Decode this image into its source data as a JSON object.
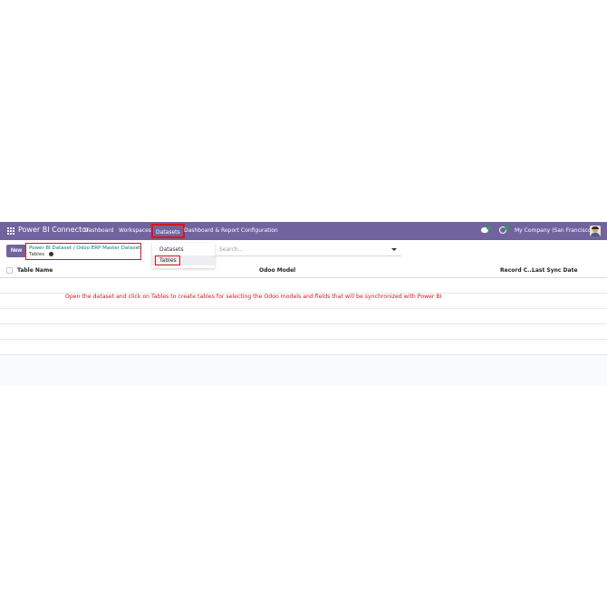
{
  "navbar": {
    "app_title": "Power BI Connector",
    "menu": [
      {
        "label": "Dashboard"
      },
      {
        "label": "Workspaces"
      },
      {
        "label": "Datasets"
      },
      {
        "label": "Dashboard & Report"
      },
      {
        "label": "Configuration"
      }
    ],
    "chat_badge_count": 8,
    "activity_badge_count": 14,
    "company": "My Company (San Francisco)"
  },
  "control_panel": {
    "new_label": "New",
    "breadcrumb": {
      "parent": "Power BI Dataset",
      "separator": "/",
      "record": "Odoo ERP Master Dataset",
      "current": "Tables"
    },
    "search_placeholder": "Search..."
  },
  "dropdown": {
    "items": [
      {
        "label": "Datasets"
      },
      {
        "label": "Tables"
      }
    ]
  },
  "table": {
    "columns": [
      "Table Name",
      "Odoo Model",
      "Record C...",
      "Last Sync Date"
    ],
    "rows": []
  },
  "annotation": "Open the dataset and click on Tables to create tables for selecting the Odoo models and fields that will be synchronized with Power BI",
  "colors": {
    "navbar": "#71639e",
    "highlight_border": "#e0101a",
    "breadcrumb_link": "#017e84",
    "badge": "#28a745"
  },
  "icons": [
    "apps-grid-icon",
    "chat-icon",
    "clock-icon",
    "gear-icon",
    "caret-down-icon",
    "avatar"
  ]
}
